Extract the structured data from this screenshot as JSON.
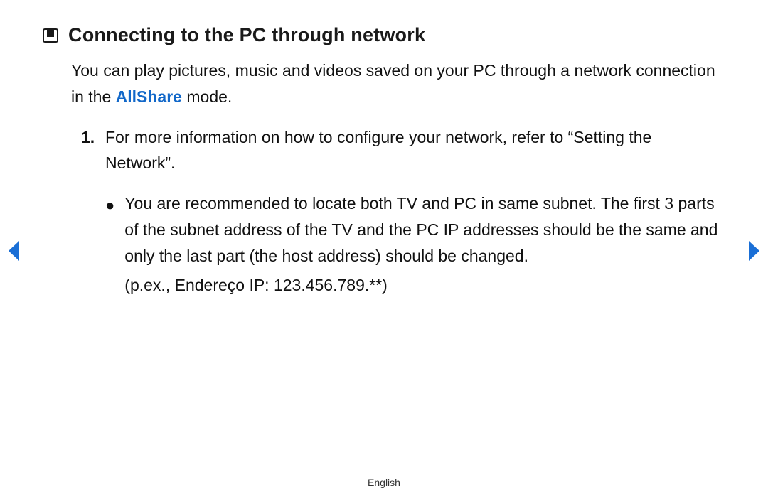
{
  "heading": "Connecting to the PC through network",
  "intro_before": "You can play pictures, music and videos saved on your PC through a network connection in the ",
  "intro_highlight": "AllShare",
  "intro_after": " mode.",
  "ordered": {
    "num": "1.",
    "text": "For more information on how to configure your network, refer to “Setting the Network”."
  },
  "bullet": {
    "marker": "●",
    "text": "You are recommended to locate both TV and PC in same subnet. The first 3 parts of the subnet address of the TV and the PC IP addresses should be the same and only the last part (the host address) should be changed.",
    "example": "(p.ex., Endereço IP: 123.456.789.**)"
  },
  "language": "English",
  "colors": {
    "link": "#1268c9",
    "arrow": "#1a6fd6"
  }
}
